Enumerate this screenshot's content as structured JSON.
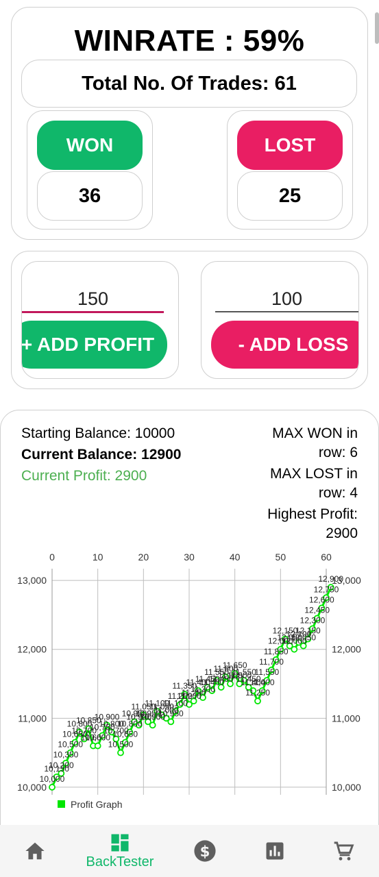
{
  "stats": {
    "winrate_label": "WINRATE : 59%",
    "total_trades_label": "Total No. Of Trades: 61",
    "won_label": "WON",
    "won_count": "36",
    "lost_label": "LOST",
    "lost_count": "25"
  },
  "trade_input": {
    "profit_value": "150",
    "loss_value": "100",
    "add_profit_label": "+ ADD PROFIT",
    "add_loss_label": "- ADD LOSS"
  },
  "summary": {
    "starting_balance": "Starting Balance: 10000",
    "current_balance": "Current Balance: 12900",
    "current_profit": "Current Profit: 2900",
    "max_won_line1": "MAX WON in",
    "max_won_line2": "row: 6",
    "max_lost_line1": "MAX LOST in",
    "max_lost_line2": "row: 4",
    "highest_profit_line1": "Highest Profit:",
    "highest_profit_line2": "2900"
  },
  "chart_data": {
    "type": "line",
    "legend": "Profit Graph",
    "legend_position": "bottom-left",
    "x_ticks": [
      0,
      10,
      20,
      30,
      40,
      50,
      60
    ],
    "y_ticks": [
      10000,
      11000,
      12000,
      13000
    ],
    "y_tick_labels": [
      "10,000",
      "11,000",
      "12,000",
      "13,000"
    ],
    "xlim": [
      0,
      60
    ],
    "ylim": [
      9890,
      13170
    ],
    "grid": true,
    "series_color": "#00e600",
    "x": [
      0,
      1,
      2,
      3,
      4,
      5,
      6,
      7,
      8,
      9,
      10,
      11,
      12,
      13,
      14,
      15,
      16,
      17,
      18,
      19,
      20,
      21,
      22,
      23,
      24,
      25,
      26,
      27,
      28,
      29,
      30,
      31,
      32,
      33,
      34,
      35,
      36,
      37,
      38,
      39,
      40,
      41,
      42,
      43,
      44,
      45,
      46,
      47,
      48,
      49,
      50,
      51,
      52,
      53,
      54,
      55,
      56,
      57,
      58,
      59,
      60,
      61
    ],
    "y": [
      10000,
      10150,
      10200,
      10350,
      10500,
      10650,
      10800,
      10700,
      10850,
      10600,
      10600,
      10750,
      10900,
      10800,
      10700,
      10500,
      10650,
      10800,
      10950,
      10900,
      11050,
      10950,
      10900,
      11100,
      11050,
      11000,
      10950,
      11100,
      11200,
      11350,
      11200,
      11250,
      11400,
      11300,
      11450,
      11400,
      11550,
      11450,
      11600,
      11500,
      11650,
      11500,
      11550,
      11450,
      11400,
      11250,
      11400,
      11550,
      11700,
      11850,
      12000,
      12150,
      12050,
      12000,
      12100,
      12050,
      12150,
      12300,
      12450,
      12600,
      12750,
      12900
    ],
    "point_labels": [
      "10,000",
      "10,150",
      "10,200",
      "10,350",
      "10,500",
      "10,650",
      "10,800",
      "10,700",
      "10,850",
      "10,600",
      "10,600",
      "10,750",
      "10,900",
      "10,800",
      "10,700",
      "10,500",
      "10,650",
      "10,800",
      "10,950",
      "10,900",
      "11,050",
      "10,950",
      "10,900",
      "11,100",
      "11,050",
      "11,000",
      "10,950",
      "11,100",
      "11,200",
      "11,350",
      "11,200",
      "11,250",
      "11,400",
      "11,300",
      "11,450",
      "11,400",
      "11,550",
      "11,450",
      "11,600",
      "11,500",
      "11,650",
      "11,500",
      "11,550",
      "11,450",
      "11,400",
      "11,250",
      "11,400",
      "11,550",
      "11,700",
      "11,850",
      "12,000",
      "12,150",
      "12,050",
      "12,000",
      "12,100",
      "12,050",
      "12,150",
      "12,300",
      "12,450",
      "12,600",
      "12,750",
      "12,900"
    ]
  },
  "nav": {
    "active_label": "BackTester",
    "items": [
      "home-icon",
      "backtester-icon",
      "dollar-icon",
      "bar-chart-icon",
      "cart-icon"
    ]
  },
  "colors": {
    "won": "#10b76a",
    "lost": "#e91e63",
    "profit_text": "#4caf50",
    "nav_active": "#10b76a",
    "nav_inactive": "#5f5f5f"
  }
}
